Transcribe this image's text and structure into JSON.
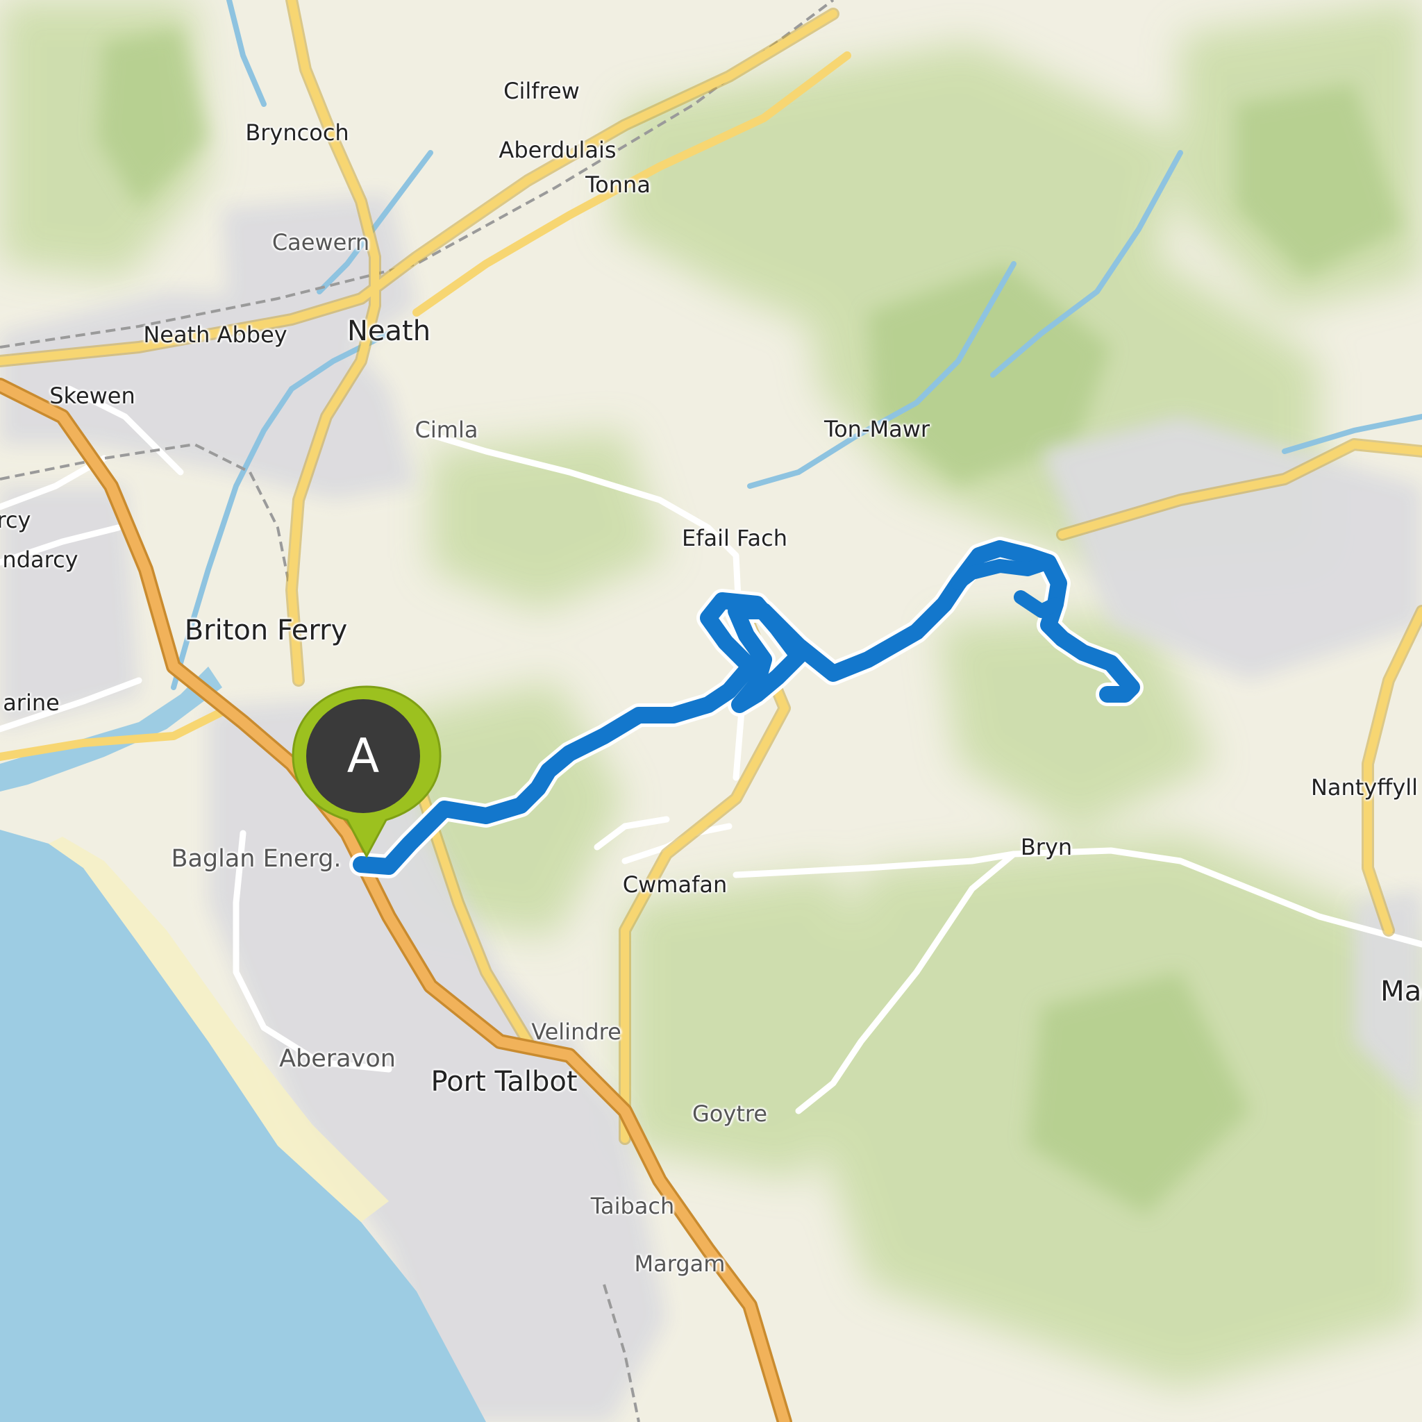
{
  "map": {
    "places": {
      "cilfrew": "Cilfrew",
      "bryncoch": "Bryncoch",
      "aberdulais": "Aberdulais",
      "tonna": "Tonna",
      "caewern": "Caewern",
      "neath_abbey": "Neath Abbey",
      "neath": "Neath",
      "skewen": "Skewen",
      "cimla": "Cimla",
      "ton_mawr": "Ton-Mawr",
      "rcy": "rcy",
      "ndarcy": "ndarcy",
      "efail_fach": "Efail Fach",
      "briton_ferry": "Briton Ferry",
      "arine": "arine",
      "nantyffyll": "Nantyffyll",
      "baglan": "Baglan Energ.",
      "bryn": "Bryn",
      "cwmafan": "Cwmafan",
      "mae": "Mae",
      "velindre": "Velindre",
      "aberavon": "Aberavon",
      "port_talbot": "Port Talbot",
      "goytre": "Goytre",
      "taibach": "Taibach",
      "margam": "Margam"
    },
    "start_marker": {
      "letter": "A"
    },
    "colors": {
      "land": "#f1efe2",
      "sea": "#9dcce3",
      "urban": "#dddde0",
      "woodland": "#c9dba5",
      "major_road": "#f7d672",
      "motorway": "#f1b25a",
      "route": "#1377cc",
      "marker": "#9cc11f",
      "marker_inner": "#3a3a3a"
    }
  }
}
